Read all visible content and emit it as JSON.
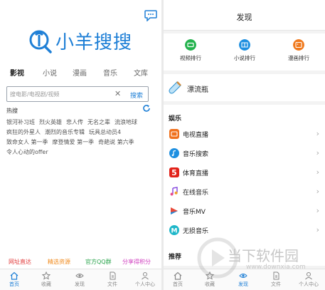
{
  "left": {
    "app_name": "小羊搜搜",
    "tabs": [
      "影视",
      "小说",
      "漫画",
      "音乐",
      "文库"
    ],
    "search": {
      "placeholder": "搜电影/电视剧/视频",
      "button": "搜索"
    },
    "hot_title": "热搜",
    "hot_rows": [
      [
        "银河补习班",
        "烈火英雄",
        "悲人传",
        "无名之辈",
        "流浪地球"
      ],
      [
        "疯狂的外星人",
        "潮烈的音乐专辑",
        "玩具总动员4"
      ],
      [
        "致命女人 第一季",
        "摩登情爱 第一季",
        "奇葩说 第六季"
      ],
      [
        "令人心动的offer"
      ]
    ],
    "bottom_links": [
      {
        "label": "网址直达",
        "color": "#e23d3d"
      },
      {
        "label": "精选资源",
        "color": "#f08a1c"
      },
      {
        "label": "官方QQ群",
        "color": "#27a34a"
      },
      {
        "label": "分享得积分",
        "color": "#d040c0"
      }
    ],
    "tabbar": [
      "首页",
      "收藏",
      "发现",
      "文件",
      "个人中心"
    ]
  },
  "right": {
    "title": "发现",
    "ranks": [
      {
        "label": "视频排行",
        "color": "#23b24d"
      },
      {
        "label": "小说排行",
        "color": "#1e8fe0"
      },
      {
        "label": "漫画排行",
        "color": "#f07a1e"
      }
    ],
    "bottle": "漂流瓶",
    "ent_title": "娱乐",
    "ent_items": [
      {
        "label": "电视直播",
        "color": "#f0711e",
        "icon": "tv-icon"
      },
      {
        "label": "音乐搜索",
        "color": "#1e8fe0",
        "icon": "music-search-icon"
      },
      {
        "label": "体育直播",
        "color": "#e2231a",
        "icon": "sports-icon"
      },
      {
        "label": "在线音乐",
        "color": "#8a4fe0",
        "icon": "music-note-icon"
      },
      {
        "label": "音乐MV",
        "color": "#e84a3a",
        "icon": "play-icon"
      },
      {
        "label": "无损音乐",
        "color": "#1fb7c9",
        "icon": "m-icon"
      }
    ],
    "rec_title": "推荐",
    "tabbar": [
      "首页",
      "收藏",
      "发现",
      "文件",
      "个人中心"
    ]
  },
  "watermark": {
    "name": "当下软件园",
    "url": "www.downxia.com"
  },
  "colors": {
    "accent": "#1e7fd6",
    "divider": "#e9e9e9"
  }
}
